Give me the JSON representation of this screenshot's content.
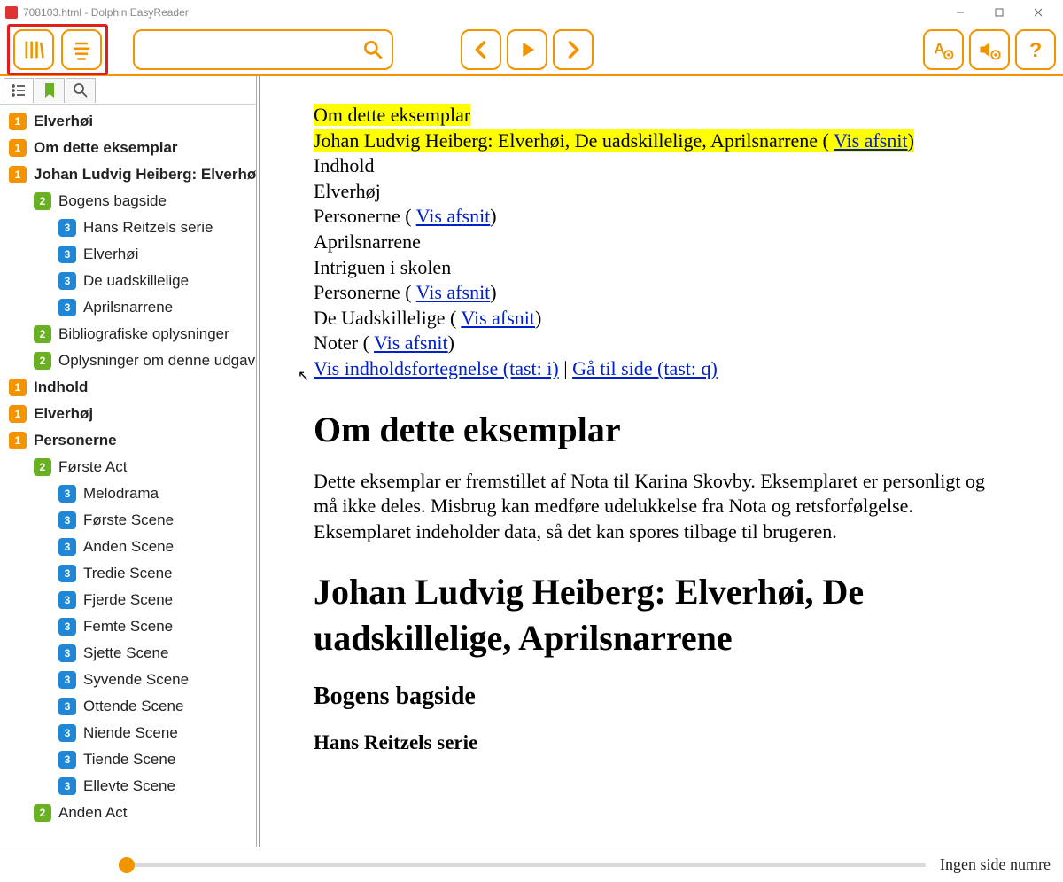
{
  "window": {
    "title": "708103.html - Dolphin EasyReader"
  },
  "toolbar": {
    "search_placeholder": ""
  },
  "tree": [
    {
      "lvl": 1,
      "num": "1",
      "label": "Elverhøi"
    },
    {
      "lvl": 1,
      "num": "1",
      "label": "Om dette eksemplar"
    },
    {
      "lvl": 1,
      "num": "1",
      "label": "Johan Ludvig Heiberg: Elverhøi, De uadskillelige, Aprilsnarrene"
    },
    {
      "lvl": 2,
      "num": "2",
      "label": "Bogens bagside"
    },
    {
      "lvl": 3,
      "num": "3",
      "label": "Hans Reitzels serie"
    },
    {
      "lvl": 3,
      "num": "3",
      "label": "Elverhøi"
    },
    {
      "lvl": 3,
      "num": "3",
      "label": "De uadskillelige"
    },
    {
      "lvl": 3,
      "num": "3",
      "label": "Aprilsnarrene"
    },
    {
      "lvl": 2,
      "num": "2",
      "label": "Bibliografiske oplysninger"
    },
    {
      "lvl": 2,
      "num": "2",
      "label": "Oplysninger om denne udgave"
    },
    {
      "lvl": 1,
      "num": "1",
      "label": "Indhold"
    },
    {
      "lvl": 1,
      "num": "1",
      "label": "Elverhøj"
    },
    {
      "lvl": 1,
      "num": "1",
      "label": "Personerne"
    },
    {
      "lvl": 2,
      "num": "2",
      "label": "Første Act"
    },
    {
      "lvl": 3,
      "num": "3",
      "label": "Melodrama"
    },
    {
      "lvl": 3,
      "num": "3",
      "label": "Første Scene"
    },
    {
      "lvl": 3,
      "num": "3",
      "label": "Anden Scene"
    },
    {
      "lvl": 3,
      "num": "3",
      "label": "Tredie Scene"
    },
    {
      "lvl": 3,
      "num": "3",
      "label": "Fjerde Scene"
    },
    {
      "lvl": 3,
      "num": "3",
      "label": "Femte Scene"
    },
    {
      "lvl": 3,
      "num": "3",
      "label": "Sjette Scene"
    },
    {
      "lvl": 3,
      "num": "3",
      "label": "Syvende Scene"
    },
    {
      "lvl": 3,
      "num": "3",
      "label": "Ottende Scene"
    },
    {
      "lvl": 3,
      "num": "3",
      "label": "Niende Scene"
    },
    {
      "lvl": 3,
      "num": "3",
      "label": "Tiende Scene"
    },
    {
      "lvl": 3,
      "num": "3",
      "label": "Ellevte Scene"
    },
    {
      "lvl": 2,
      "num": "2",
      "label": "Anden Act"
    }
  ],
  "content": {
    "hl1": "Om dette eksemplar",
    "hl2_pre": "Johan Ludvig Heiberg: Elverhøi, De uadskillelige, Aprilsnarrene ( ",
    "hl2_link": "Vis afsnit",
    "hl2_post": ")",
    "l3": "Indhold",
    "l4": "Elverhøj",
    "l5_pre": "Personerne ( ",
    "l5_link": "Vis afsnit",
    "l5_post": ")",
    "l6": "Aprilsnarrene",
    "l7": "Intriguen i skolen",
    "l8_pre": "Personerne ( ",
    "l8_link": "Vis afsnit",
    "l8_post": ")",
    "l9_pre": "De Uadskillelige ( ",
    "l9_link": "Vis afsnit",
    "l9_post": ")",
    "l10_pre": "Noter ( ",
    "l10_link": "Vis afsnit",
    "l10_post": ")",
    "nav1": "Vis indholdsfortegnelse (tast: i)",
    "nav_sep": " | ",
    "nav2": "Gå til side (tast: q)",
    "h1a": "Om dette eksemplar",
    "p1": "Dette eksemplar er fremstillet af Nota til Karina Skovby. Eksemplaret er personligt og må ikke deles. Misbrug kan medføre udelukkelse fra Nota og retsforfølgelse. Eksemplaret indeholder data, så det kan spores tilbage til brugeren.",
    "h1b": "Johan Ludvig Heiberg: Elverhøi, De uadskillelige, Aprilsnarrene",
    "h2a": "Bogens bagside",
    "h3a": "Hans Reitzels serie"
  },
  "footer": {
    "page_label": "Ingen side numre"
  }
}
